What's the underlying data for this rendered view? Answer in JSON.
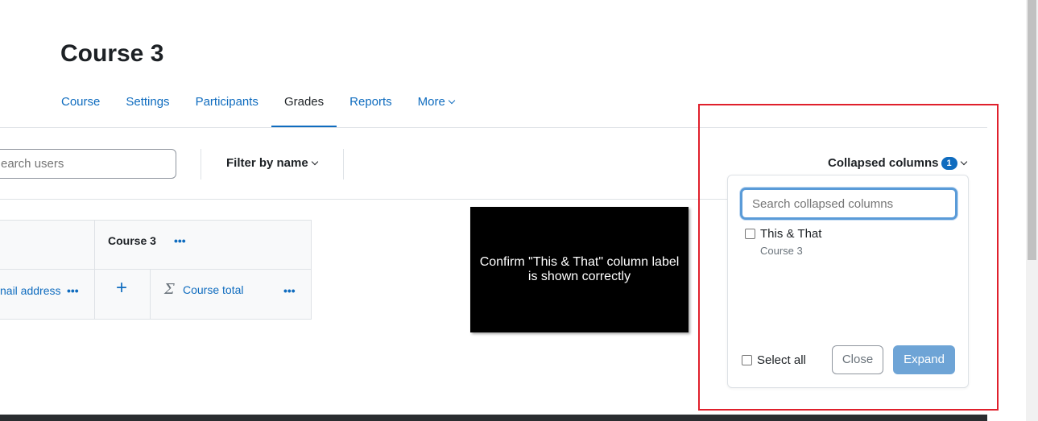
{
  "page": {
    "title": "Course 3"
  },
  "nav": {
    "items": [
      {
        "label": "Course"
      },
      {
        "label": "Settings"
      },
      {
        "label": "Participants"
      },
      {
        "label": "Grades",
        "active": true
      },
      {
        "label": "Reports"
      },
      {
        "label": "More"
      }
    ]
  },
  "toolbar": {
    "search_placeholder": "earch users",
    "filter_label": "Filter by name",
    "collapsed_label": "Collapsed columns",
    "collapsed_count": "1"
  },
  "grid": {
    "category_header": "Course 3",
    "email_header": "nail address",
    "total_header": "Course total",
    "plus": "+",
    "sigma": "Σ",
    "dots": "•••"
  },
  "overlay": {
    "message": "Confirm \"This & That\" column label is shown correctly"
  },
  "dropdown": {
    "search_placeholder": "Search collapsed columns",
    "item_label": "This & That",
    "item_sub": "Course 3",
    "select_all_label": "Select all",
    "close_label": "Close",
    "expand_label": "Expand"
  },
  "colors": {
    "accent": "#0f6cbf",
    "highlight_border": "#e0202c",
    "expand_button": "#6ea4d6"
  }
}
